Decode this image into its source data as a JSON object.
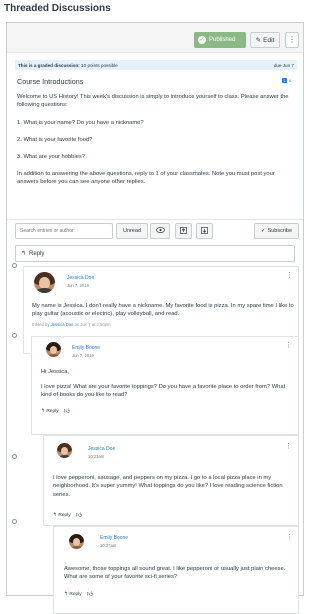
{
  "page": {
    "title": "Threaded Discussions"
  },
  "toolbar": {
    "published_label": "Published",
    "edit_label": "Edit",
    "more_label": "⋮"
  },
  "topic": {
    "graded_notice_bold": "This is a graded discussion:",
    "graded_notice_points": " 10 points possible",
    "due": "due Jun 7",
    "title": "Course Introductions",
    "unread_count": "1",
    "total_count": "6",
    "paragraphs": [
      "Welcome to US History! This week's discussion is simply to introduce yourself to class. Please answer the following questions:",
      "1. What is your name? Do you have a nickname?",
      "2. What is your favorite food?",
      "3. What are your hobbies?",
      "In addition to answering the above questions, reply to 1 of your classmates. Note you must post your answers before you can see anyone other replies."
    ]
  },
  "search": {
    "placeholder": "Search entries or author",
    "unread_label": "Unread",
    "subscribe_label": "Subscribe"
  },
  "reply_label": "Reply",
  "entries": [
    {
      "author": "Jessica Doe",
      "date": "Jun 7, 2019",
      "body": [
        "My name is Jessica. I don't really have a nickname. My favorite food is pizza. In my spare time I like to play guitar (acoustic or electric), play volleyball, and read."
      ],
      "edited_prefix": "Edited by ",
      "edited_by": "Jessica Doe",
      "edited_suffix": " on Jun 7 at 2:50pm"
    },
    {
      "author": "Emily Boone",
      "date": "Jun 7, 2019",
      "body": [
        "Hi Jessica,",
        "I love pizza! What are your favorite toppings? Do you have a favorite place to order from? What kind of books do you like to read?"
      ],
      "reply_label": "Reply"
    },
    {
      "author": "Jessica Doe",
      "date": "10:23am",
      "body": [
        "I love pepperoni, sausage, and peppers on my pizza. I go to a local pizza place in my neighborhood. It's super yummy! What toppings do you like? I love reading science fiction series."
      ],
      "reply_label": "Reply"
    },
    {
      "author": "Emily Boone",
      "date": "10:27am",
      "body": [
        "Awesome, those toppings all sound great. I like pepperoni or usually just plain cheese. What are some of your favorite sci-fi series?"
      ],
      "reply_label": "Reply"
    }
  ],
  "colors": {
    "accent": "#2b7abc",
    "published": "#8ab985",
    "banner": "#e5f1f8"
  },
  "icons": [
    "check-circle-icon",
    "pencil-icon",
    "kebab-icon",
    "eye-icon",
    "upload-icon",
    "download-icon",
    "checkmark-icon",
    "reply-arrow-icon",
    "thumbs-up-icon"
  ]
}
